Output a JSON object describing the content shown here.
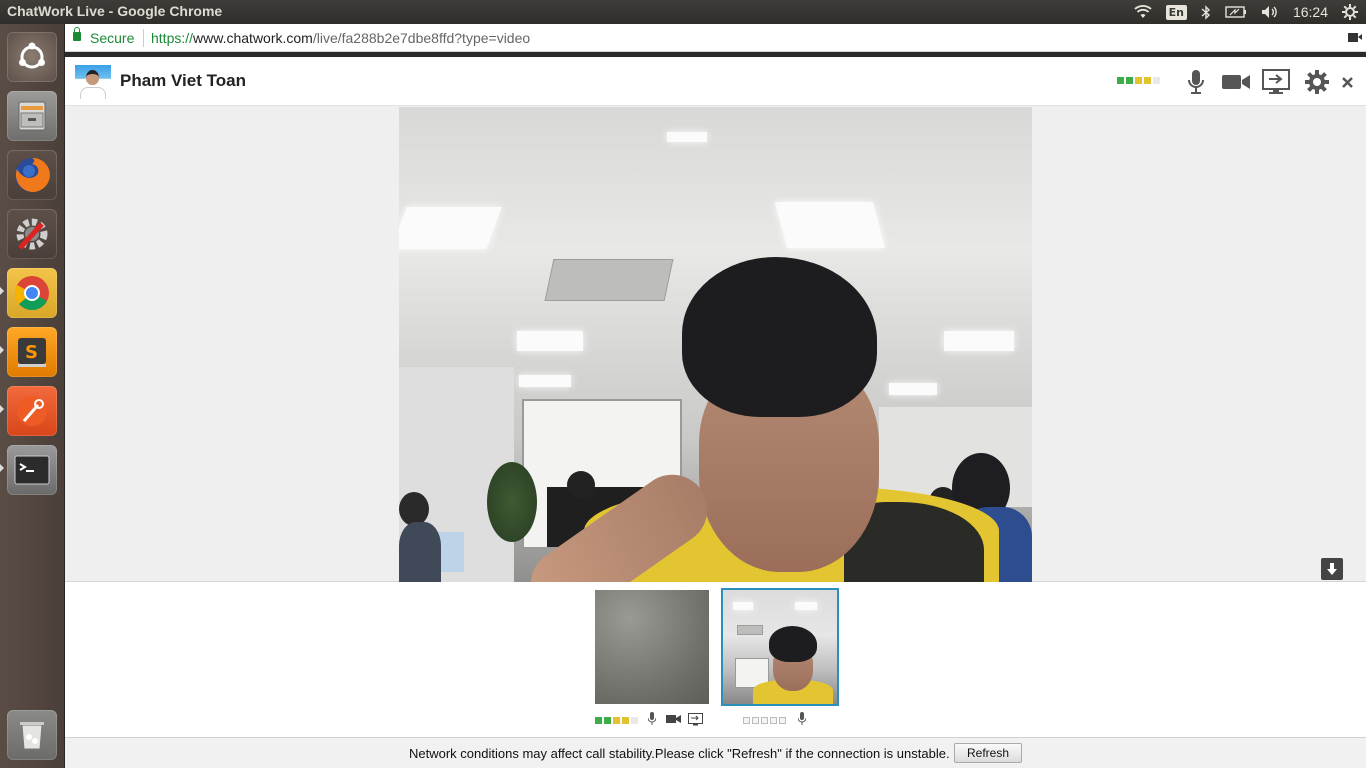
{
  "window": {
    "title": "ChatWork Live - Google Chrome"
  },
  "tray": {
    "language": "En",
    "time": "16:24"
  },
  "launcher": {
    "items": [
      {
        "name": "ubuntu-dash",
        "color": "#e05a2b"
      },
      {
        "name": "files",
        "color": "#8a8a88"
      },
      {
        "name": "firefox",
        "color": "#e66000"
      },
      {
        "name": "system-settings",
        "color": "#9a9a9a"
      },
      {
        "name": "google-chrome",
        "color": "#f2f2f2"
      },
      {
        "name": "sublime-text",
        "color": "#ff9800"
      },
      {
        "name": "postman",
        "color": "#ef5b25"
      },
      {
        "name": "terminal",
        "color": "#2c2c2c"
      },
      {
        "name": "trash",
        "color": "#8a8a88"
      }
    ]
  },
  "address": {
    "secure_label": "Secure",
    "scheme": "https://",
    "host": "www.chatwork.com",
    "path": "/live/fa288b2e7dbe8ffd?type=video"
  },
  "call": {
    "caller_name": "Pham Viet Toan",
    "signal_colors": [
      "#3bae48",
      "#3bae48",
      "#e4c22f",
      "#e4c22f",
      "#e8e8e8"
    ],
    "tools": [
      "microphone-icon",
      "video-camera-icon",
      "screen-share-icon",
      "settings-gear-icon",
      "close-icon"
    ]
  },
  "thumbnails": [
    {
      "name": "remote-participant",
      "signal_colors": [
        "#3bae48",
        "#3bae48",
        "#e4c22f",
        "#e4c22f",
        "#e8e8e8"
      ],
      "icons": [
        "microphone-icon",
        "video-camera-icon",
        "screen-share-icon"
      ]
    },
    {
      "name": "local-participant",
      "signal_colors": [
        "#f4f4f4",
        "#f4f4f4",
        "#f4f4f4",
        "#f4f4f4",
        "#f4f4f4"
      ],
      "icons": [
        "microphone-icon"
      ]
    }
  ],
  "notice": {
    "message": "Network conditions may affect call stability.Please click \"Refresh\" if the connection is unstable.",
    "refresh_label": "Refresh"
  }
}
